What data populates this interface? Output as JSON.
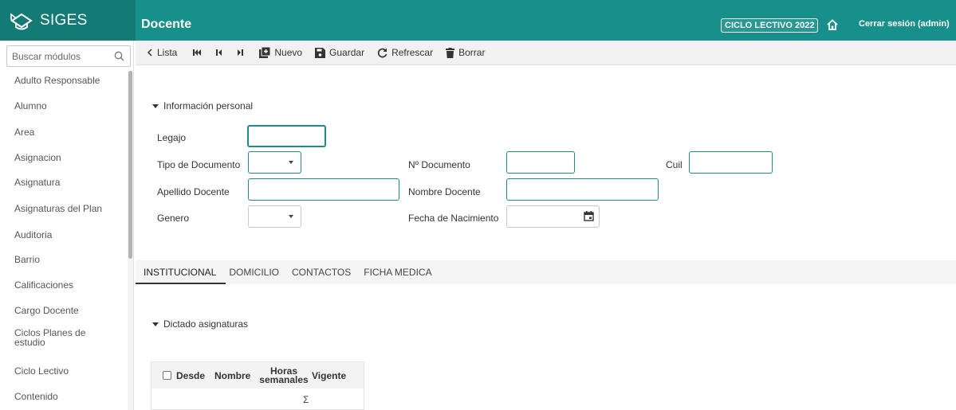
{
  "app": {
    "name": "SIGES",
    "page_title": "Docente",
    "cycle_badge": "CICLO LECTIVO 2022",
    "logout": "Cerrar sesión (admin)",
    "accent_color": "#178f8a"
  },
  "sidebar": {
    "search_placeholder": "Buscar módulos",
    "items": [
      "Adulto Responsable",
      "Alumno",
      "Area",
      "Asignacion",
      "Asignatura",
      "Asignaturas del Plan",
      "Auditoria",
      "Barrio",
      "Calificaciones",
      "Cargo Docente",
      "Ciclos Planes de estudio",
      "Ciclo Lectivo",
      "Contenido"
    ]
  },
  "toolbar": {
    "list_label": "Lista",
    "new_label": "Nuevo",
    "save_label": "Guardar",
    "refresh_label": "Refrescar",
    "delete_label": "Borrar"
  },
  "form": {
    "section_personal": "Información personal",
    "legajo": "Legajo",
    "tipo_documento": "Tipo de Documento",
    "nro_documento": "Nº Documento",
    "cuil": "Cuil",
    "apellido": "Apellido Docente",
    "nombre": "Nombre Docente",
    "genero": "Genero",
    "fecha_nacimiento": "Fecha de Nacimiento"
  },
  "tabs": [
    "INSTITUCIONAL",
    "DOMICILIO",
    "CONTACTOS",
    "FICHA MEDICA"
  ],
  "active_tab": "INSTITUCIONAL",
  "dictado": {
    "section_title": "Dictado asignaturas",
    "columns": {
      "desde": "Desde",
      "nombre": "Nombre",
      "horas_line1": "Horas",
      "horas_line2": "semanales",
      "vigente": "Vigente"
    },
    "sum_symbol": "Σ"
  }
}
